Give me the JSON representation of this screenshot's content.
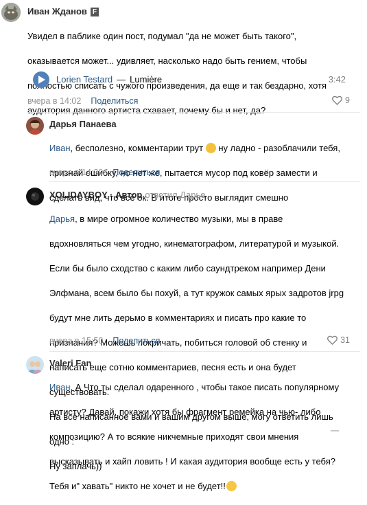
{
  "post": {
    "author": "Иван Жданов",
    "badge": "F",
    "lines": [
      "Увидел в паблике один пост, подумал \"да не может быть такого\",",
      "оказывается может... удивляет, насколько надо быть гением, чтобы",
      "полностью списать с чужого произведения, да еще и так бездарно, хотя",
      "аудитория данного артиста схавает, почему бы и нет, да?"
    ],
    "audio": {
      "artist": "Lorien Testard",
      "separator": "—",
      "title": "Lumière",
      "duration": "3:42"
    },
    "time": "вчера в 14:02",
    "share_label": "Поделиться",
    "likes": "9"
  },
  "replies": [
    {
      "author": "Дарья Панаева",
      "mention": "Иван",
      "lines": [
        ", бесполезно, комментарии трут ",
        "ну ладно - разоблачили тебя,",
        "признай ошибку, но нет же, пытается мусор под ковёр замести и",
        "сделать вид, что всё ок. В итоге просто выглядит смешно"
      ],
      "time": "вчера в 14:39",
      "share_label": "Поделиться"
    },
    {
      "author": "XOLIDAYBOY",
      "author_suffix": " · Автор",
      "replied": "ответил Дарье",
      "mention": "Дарья",
      "lines": [
        ", в мире огромное количество музыки, мы в праве",
        "вдохновляться чем угодно, кинематографом, литературой и музыкой.",
        "Если бы было сходство с каким либо саундтреком например Дени",
        "Элфмана, всем было бы похуй, а тут кружок самых ярых задротов jrpg",
        "будут мне лить дерьмо в комментариях и писать про какие то",
        "признания? Можешь покричать, побиться головой об стенку и",
        "написать еще сотню комментариев, песня есть и она будет",
        "существовать.",
        "На всё написанное вами и вашим другом выше, могу ответить лишь",
        "одно :",
        "Ну заплачь))"
      ],
      "time": "вчера в 15:50",
      "share_label": "Поделиться",
      "likes": "31"
    },
    {
      "author": "Valeri Fan",
      "mention": "Иван",
      "lines": [
        ", А Что ты сделал одаренного , чтобы такое писать популярному",
        "артисту? Давай, покажи хотя бы фрагмент ремейка на чью- либо",
        "композицию? А то всякие никчемные приходят свои мнения",
        "высказывать и хайп ловить ! И какая аудитория вообще есть у тебя?",
        "Тебя и\" хавать\" никто не хочет и не будет!!"
      ]
    }
  ],
  "colors": {
    "link": "#2a5885",
    "meta": "#939393",
    "play": "#5181b8"
  }
}
